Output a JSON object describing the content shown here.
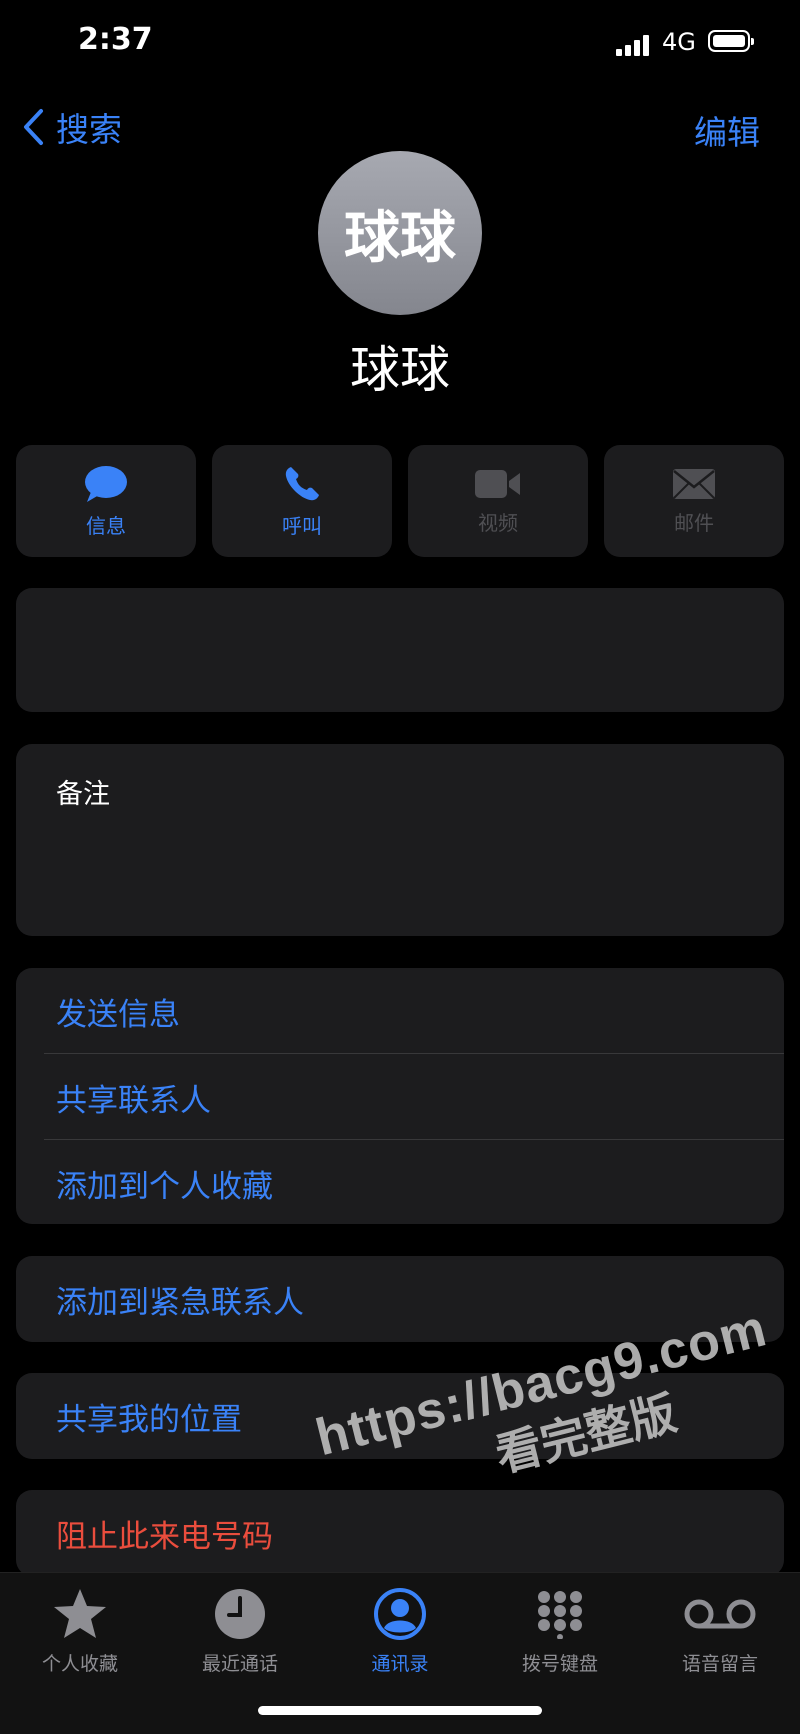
{
  "status_bar": {
    "time": "2:37",
    "network": "4G"
  },
  "nav": {
    "back_label": "搜索",
    "edit_label": "编辑"
  },
  "contact": {
    "avatar_text": "球球",
    "name": "球球"
  },
  "actions": [
    {
      "label": "信息",
      "icon": "message-icon",
      "enabled": true
    },
    {
      "label": "呼叫",
      "icon": "phone-icon",
      "enabled": true
    },
    {
      "label": "视频",
      "icon": "video-icon",
      "enabled": false
    },
    {
      "label": "邮件",
      "icon": "mail-icon",
      "enabled": false
    }
  ],
  "notes": {
    "label": "备注"
  },
  "options_group": [
    "发送信息",
    "共享联系人",
    "添加到个人收藏"
  ],
  "emergency": {
    "label": "添加到紧急联系人"
  },
  "location": {
    "label": "共享我的位置"
  },
  "block": {
    "label": "阻止此来电号码"
  },
  "tabs": [
    {
      "label": "个人收藏",
      "icon": "star-icon",
      "active": false
    },
    {
      "label": "最近通话",
      "icon": "clock-icon",
      "active": false
    },
    {
      "label": "通讯录",
      "icon": "person-circle-icon",
      "active": true
    },
    {
      "label": "拨号键盘",
      "icon": "keypad-icon",
      "active": false
    },
    {
      "label": "语音留言",
      "icon": "voicemail-icon",
      "active": false
    }
  ],
  "watermark": {
    "line1": "https://bacg9.com",
    "line2": "看完整版"
  },
  "colors": {
    "accent": "#3a82f7",
    "destructive": "#ea4d3d",
    "card": "#1c1c1e",
    "disabled": "#4f4f53"
  }
}
